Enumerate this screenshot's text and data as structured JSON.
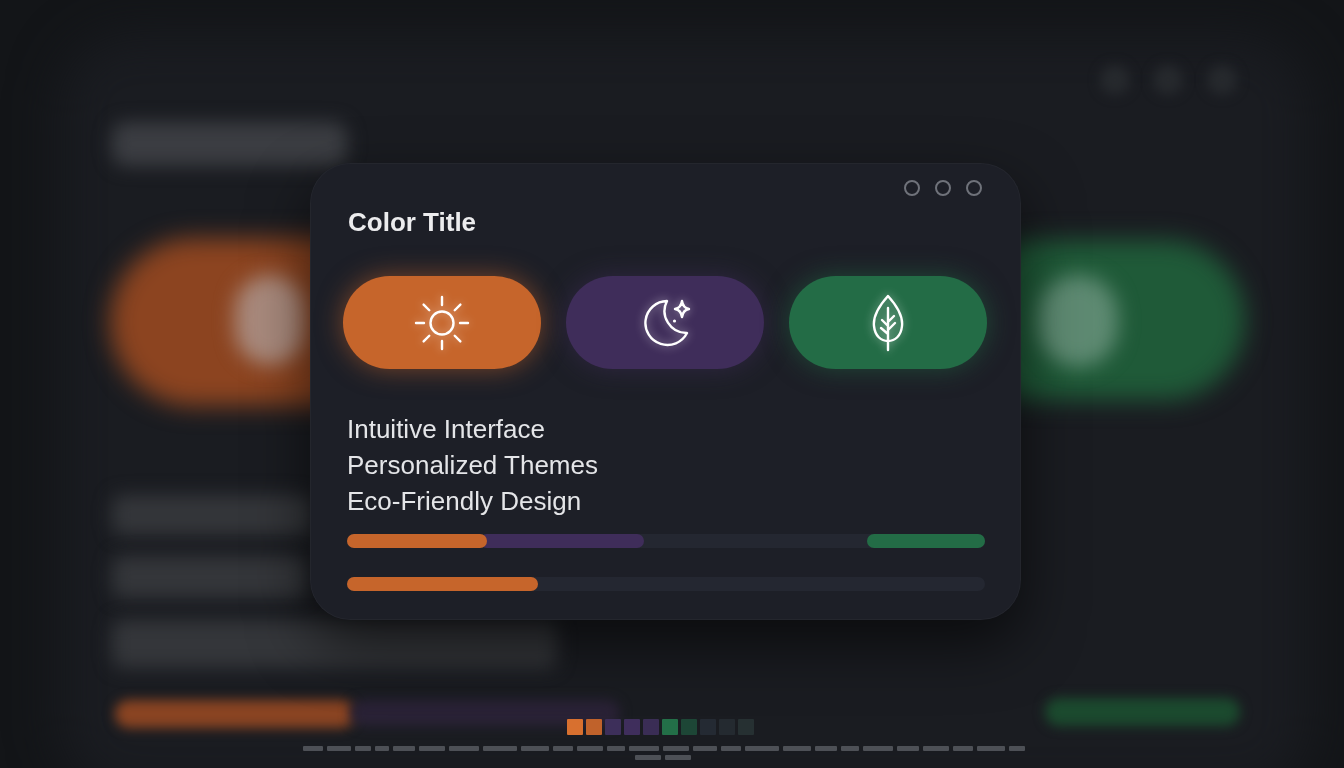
{
  "card": {
    "title": "Color Title",
    "theme_buttons": [
      {
        "kind": "sun",
        "color": "#c6652b"
      },
      {
        "kind": "moon",
        "color": "#3f2d5a"
      },
      {
        "kind": "leaf",
        "color": "#236c46"
      }
    ],
    "features": [
      "Intuitive Interface",
      "Personalized Themes",
      "Eco-Friendly Design"
    ],
    "bars": [
      {
        "segments": [
          {
            "kind": "start",
            "color": "#c6652b",
            "level": 0.22
          },
          {
            "kind": "start",
            "color": "#3f2d5a",
            "level": 0.245
          },
          {
            "kind": "end",
            "color": "#236c46",
            "level": 0.185
          }
        ]
      },
      {
        "segments": [
          {
            "kind": "start",
            "color": "#c6652b",
            "level": 0.3
          }
        ]
      }
    ]
  },
  "swatches": [
    {
      "color": "#d8702f"
    },
    {
      "color": "#c0622b"
    },
    {
      "color": "#3d2f5a"
    },
    {
      "color": "#3f2e5c"
    },
    {
      "color": "#3a2d55"
    },
    {
      "color": "#236f48"
    },
    {
      "color": "#1d4636"
    },
    {
      "color": "#242a33"
    },
    {
      "color": "#242a30"
    },
    {
      "color": "#263032"
    }
  ]
}
